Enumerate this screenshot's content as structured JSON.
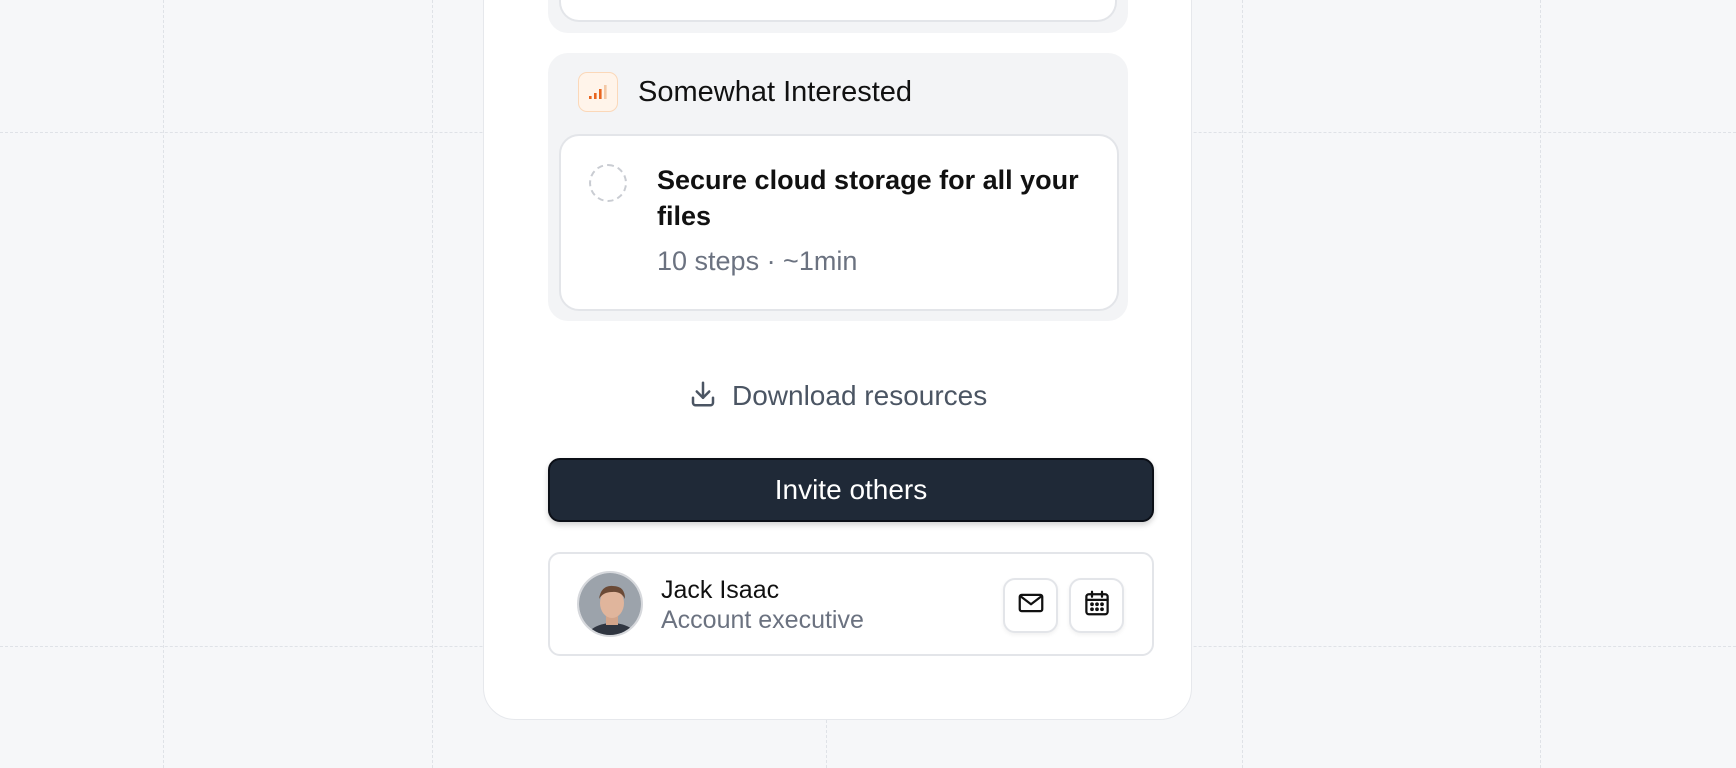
{
  "previous_group": {},
  "group": {
    "title": "Somewhat Interested",
    "level_icon": "signal-bars-icon",
    "accent_color": "#e8651f",
    "task": {
      "title": "Secure cloud storage for all your files",
      "meta": "10 steps · ~1min",
      "status_icon": "pending-circle-icon"
    }
  },
  "actions": {
    "download_label": "Download resources",
    "download_icon": "download-icon",
    "invite_label": "Invite others",
    "invite_color": "#1f2937"
  },
  "contact": {
    "name": "Jack Isaac",
    "role": "Account executive",
    "mail_icon": "mail-icon",
    "calendar_icon": "calendar-icon"
  }
}
